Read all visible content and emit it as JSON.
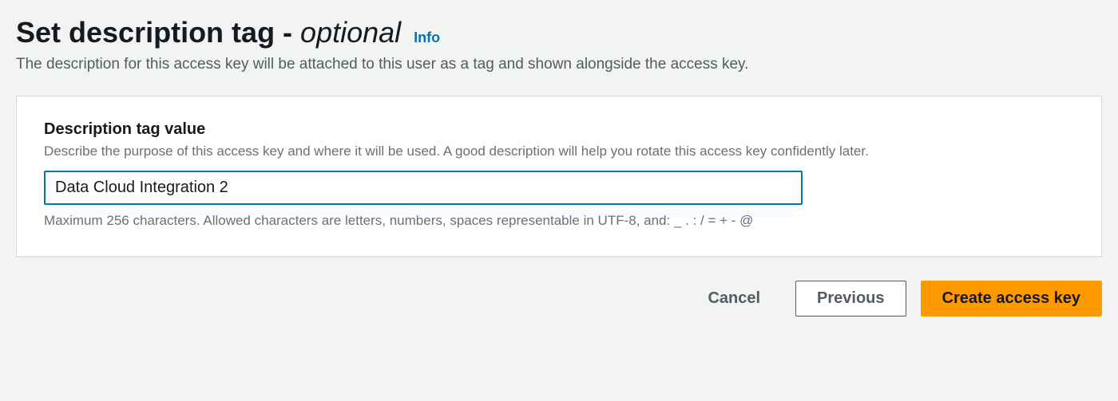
{
  "header": {
    "title_main": "Set description tag - ",
    "title_optional": "optional",
    "info_label": "Info",
    "subtitle": "The description for this access key will be attached to this user as a tag and shown alongside the access key."
  },
  "form": {
    "description_tag": {
      "label": "Description tag value",
      "hint": "Describe the purpose of this access key and where it will be used. A good description will help you rotate this access key confidently later.",
      "value": "Data Cloud Integration 2",
      "constraint": "Maximum 256 characters. Allowed characters are letters, numbers, spaces representable in UTF-8, and: _ . : / = + - @"
    }
  },
  "buttons": {
    "cancel": "Cancel",
    "previous": "Previous",
    "create": "Create access key"
  }
}
